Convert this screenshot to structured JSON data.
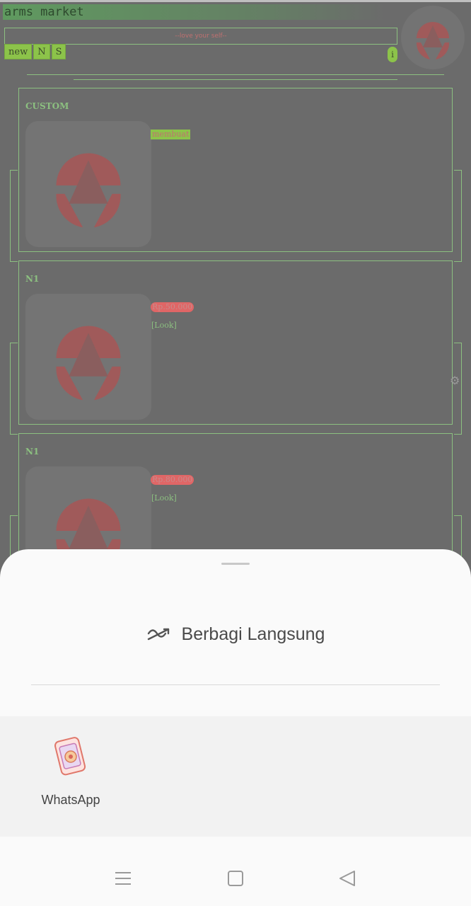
{
  "app": {
    "title": "arms market",
    "tagline": "--love your self--",
    "tabs": [
      "new",
      "N",
      "S"
    ],
    "info_label": "i"
  },
  "cards": [
    {
      "title": "CUSTOM",
      "badge": "membuat",
      "badge_style": "green",
      "link": ""
    },
    {
      "title": "N1",
      "badge": "Rp.50.000",
      "badge_style": "red",
      "link": "[Look]"
    },
    {
      "title": "N1",
      "badge": "Rp.80.000",
      "badge_style": "red",
      "link": "[Look]"
    }
  ],
  "share_sheet": {
    "title": "Berbagi Langsung",
    "apps": [
      {
        "label": "WhatsApp"
      }
    ]
  },
  "colors": {
    "accent_green": "#8cc34a",
    "line_green": "#8cc080",
    "logo_red": "#b06060",
    "price_red": "#e06666"
  }
}
